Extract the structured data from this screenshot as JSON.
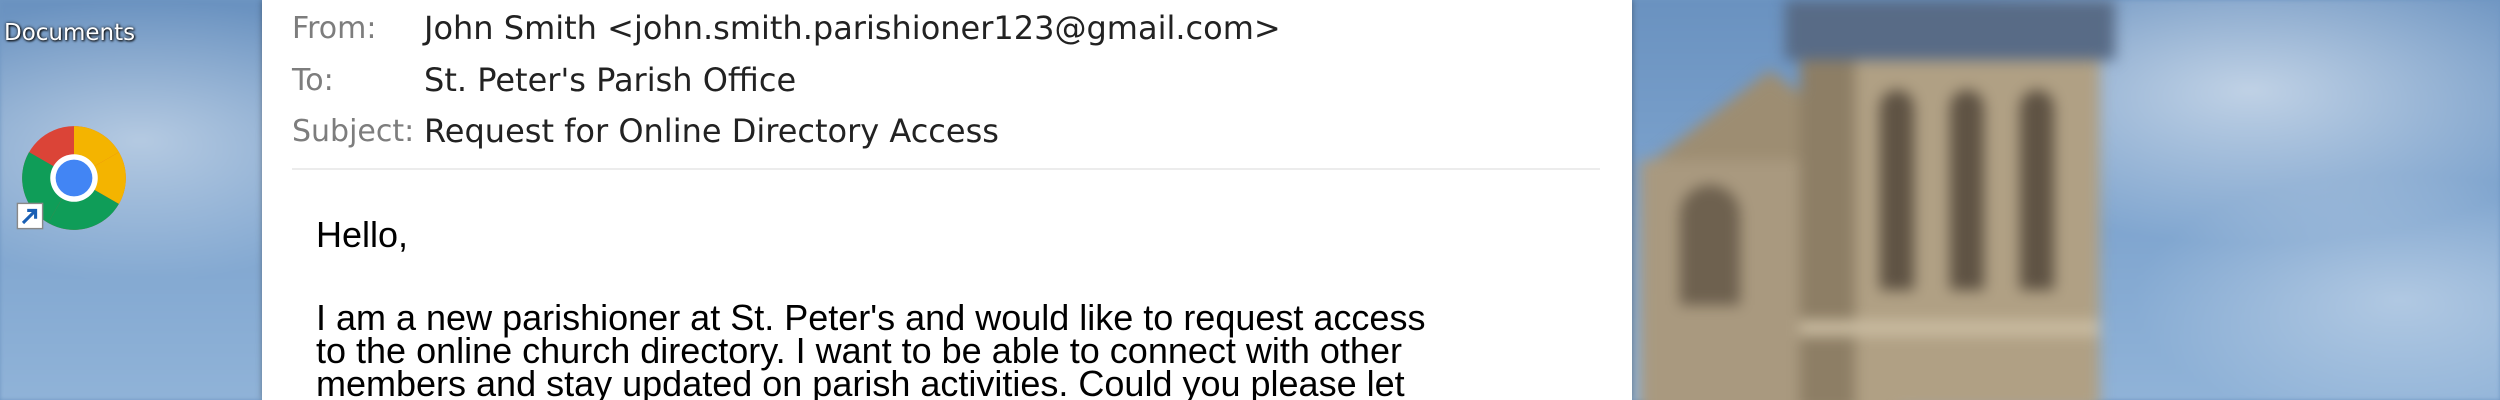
{
  "desktop": {
    "icons": [
      {
        "label": "Documents",
        "icon": "documents-folder-icon"
      },
      {
        "label": "",
        "icon": "chrome-icon",
        "shortcut": true
      }
    ]
  },
  "email": {
    "headers": {
      "from_label": "From:",
      "from_value": "John Smith <john.smith.parishioner123@gmail.com>",
      "to_label": "To:",
      "to_value": "St. Peter's Parish Office",
      "subject_label": "Subject:",
      "subject_value": "Request for Online Directory Access"
    },
    "body": {
      "greeting": "Hello,",
      "lines": [
        "I am a new parishioner at St. Peter's and would like to request access",
        "to the online church directory. I want to be able to connect with other",
        "members and stay updated on parish activities. Could you please let"
      ]
    }
  },
  "colors": {
    "window_bg": "#ffffff",
    "label_gray": "#7d7d7d",
    "sky_blue": "#7fa5cf"
  }
}
